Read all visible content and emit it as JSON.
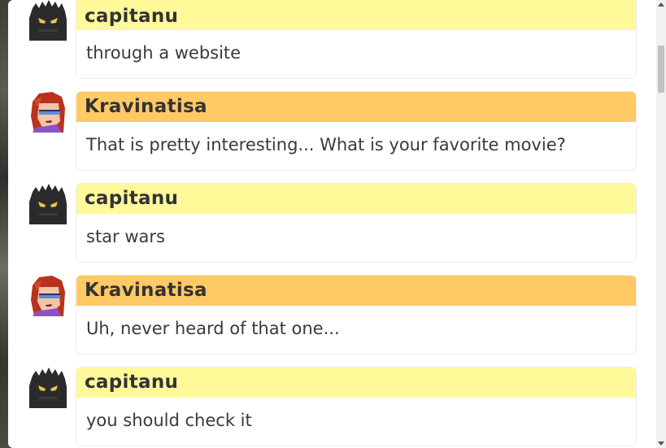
{
  "colors": {
    "self_header": "#fff99a",
    "other_header": "#ffc966",
    "card_bg": "#ffffff"
  },
  "messages": [
    {
      "author": "capitanu",
      "text": "through a website",
      "avatar": "dark-creature-avatar"
    },
    {
      "author": "Kravinatisa",
      "text": "That is pretty interesting... What is your favorite movie?",
      "avatar": "red-hair-girl-avatar"
    },
    {
      "author": "capitanu",
      "text": "star wars",
      "avatar": "dark-creature-avatar"
    },
    {
      "author": "Kravinatisa",
      "text": "Uh, never heard of that one...",
      "avatar": "red-hair-girl-avatar"
    },
    {
      "author": "capitanu",
      "text": "you should check it",
      "avatar": "dark-creature-avatar"
    }
  ]
}
